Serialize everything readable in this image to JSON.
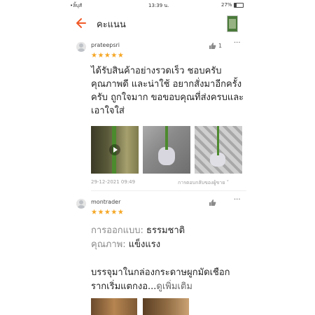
{
  "status": {
    "carrier": "•ลิ้บุสั",
    "time": "13:39 น.",
    "battery": "27%"
  },
  "header": {
    "title": "คะแนน"
  },
  "review1": {
    "username": "prateepsri",
    "stars": "★★★★★",
    "likes": "1",
    "text": "ได้รับสินค้าอย่างรวดเร็ว ชอบครับ คุณภาพดี และน่าใช้ อยากสั่งมาอีกครั้งครับ ถูกใจมาก ขอขอบคุณที่ส่งครบและเอาใจใส่",
    "date": "29-12-2021 09:49",
    "seller_reply": "การตอบกลับของผู้ขาย ˅"
  },
  "review2": {
    "username": "montrader",
    "stars": "★★★★★",
    "design_label": "การออกแบบ:",
    "design_value": "ธรรมชาติ",
    "quality_label": "คุณภาพ:",
    "quality_value": "แข็งแรง",
    "text": "บรรจุมาในกล่องกระดาษผูกมัดเชือก รากเริ่มแตกงอ...",
    "see_more": "ดูเพิ่มเติม"
  },
  "colors": {
    "accent": "#f05a28",
    "star": "#f5a623"
  }
}
